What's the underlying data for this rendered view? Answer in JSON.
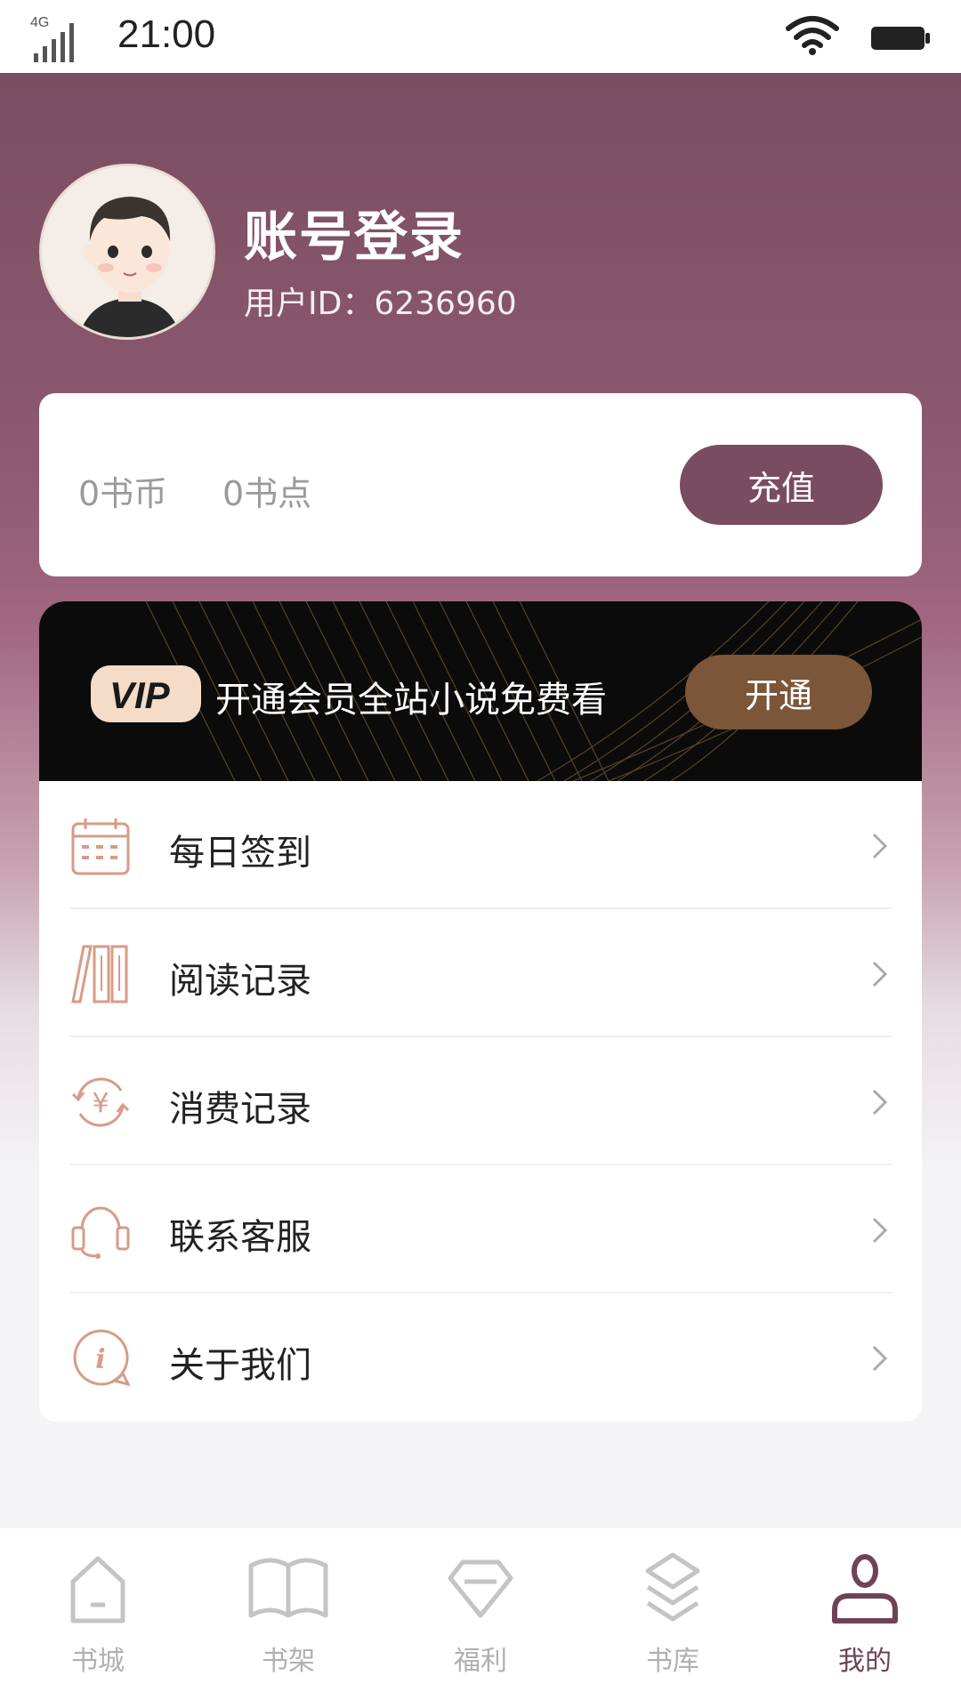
{
  "status_bar": {
    "time": "21:00",
    "network": "4G"
  },
  "profile": {
    "title": "账号登录",
    "user_id": "用户ID：6236960"
  },
  "balance": {
    "coins": "0书币",
    "points": "0书点",
    "recharge_label": "充值"
  },
  "vip": {
    "badge": "VIP",
    "text": "开通会员全站小说免费看",
    "button_label": "开通"
  },
  "menu": {
    "items": [
      {
        "label": "每日签到",
        "icon": "calendar-icon"
      },
      {
        "label": "阅读记录",
        "icon": "books-icon"
      },
      {
        "label": "消费记录",
        "icon": "yuan-exchange-icon"
      },
      {
        "label": "联系客服",
        "icon": "headset-icon"
      },
      {
        "label": "关于我们",
        "icon": "info-icon"
      }
    ]
  },
  "tabs": [
    {
      "label": "书城",
      "icon": "home-icon"
    },
    {
      "label": "书架",
      "icon": "book-open-icon"
    },
    {
      "label": "福利",
      "icon": "diamond-icon"
    },
    {
      "label": "书库",
      "icon": "layers-icon"
    },
    {
      "label": "我的",
      "icon": "user-icon",
      "active": true
    }
  ],
  "colors": {
    "accent": "#7a4c5f",
    "vip_button": "#7b5638",
    "icon_tint": "#d79b88",
    "tab_active": "#6e4356"
  }
}
